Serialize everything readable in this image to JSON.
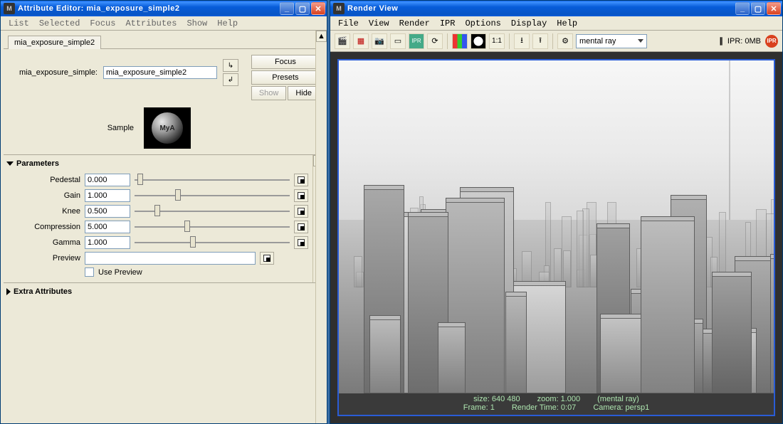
{
  "ae": {
    "title": "Attribute Editor: mia_exposure_simple2",
    "menu": [
      "List",
      "Selected",
      "Focus",
      "Attributes",
      "Show",
      "Help"
    ],
    "tab": "mia_exposure_simple2",
    "node_label": "mia_exposure_simple:",
    "node_value": "mia_exposure_simple2",
    "buttons": {
      "focus": "Focus",
      "presets": "Presets",
      "show": "Show",
      "hide": "Hide"
    },
    "sample_label": "Sample",
    "sections": {
      "parameters": {
        "title": "Parameters",
        "open": true
      },
      "extra": {
        "title": "Extra Attributes",
        "open": false
      }
    },
    "params": {
      "pedestal": {
        "label": "Pedestal",
        "value": "0.000",
        "slider_pct": 2
      },
      "gain": {
        "label": "Gain",
        "value": "1.000",
        "slider_pct": 26
      },
      "knee": {
        "label": "Knee",
        "value": "0.500",
        "slider_pct": 13
      },
      "compression": {
        "label": "Compression",
        "value": "5.000",
        "slider_pct": 32
      },
      "gamma": {
        "label": "Gamma",
        "value": "1.000",
        "slider_pct": 36
      },
      "preview": {
        "label": "Preview",
        "value": ""
      },
      "use_preview": {
        "label": "Use Preview"
      }
    }
  },
  "rv": {
    "title": "Render View",
    "menu": [
      "File",
      "View",
      "Render",
      "IPR",
      "Options",
      "Display",
      "Help"
    ],
    "renderer_label": "mental ray",
    "ipr_label": "IPR: 0MB",
    "status": {
      "line1": {
        "size": "size:  640  480",
        "zoom": "zoom: 1.000",
        "renderer": "(mental ray)"
      },
      "line2": {
        "frame": "Frame: 1",
        "time": "Render Time: 0:07",
        "camera": "Camera: persp1"
      }
    },
    "icons": [
      "clapper",
      "film",
      "camera",
      "frame",
      "ipr",
      "refresh",
      "rgb",
      "alpha",
      "one-to-one",
      "save",
      "load",
      "settings"
    ],
    "ratio": "1:1"
  }
}
